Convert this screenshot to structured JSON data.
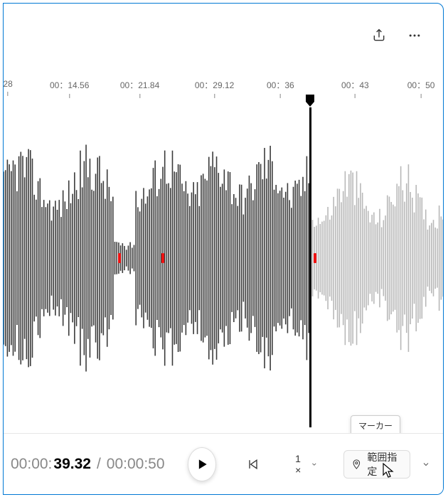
{
  "ruler": {
    "ticks": [
      {
        "label": "28",
        "x_pct": 1
      },
      {
        "label": "00：14.56",
        "x_pct": 15
      },
      {
        "label": "00：21.84",
        "x_pct": 31
      },
      {
        "label": "00：29.12",
        "x_pct": 48
      },
      {
        "label": "00：36",
        "x_pct": 63
      },
      {
        "label": "00：43",
        "x_pct": 80
      },
      {
        "label": "00：50",
        "x_pct": 95
      }
    ]
  },
  "playhead": {
    "x_pct": 69.5
  },
  "markers": [
    {
      "x_pct": 26
    },
    {
      "x_pct": 36
    },
    {
      "x_pct": 70.5
    }
  ],
  "tooltip": {
    "text": "マーカー"
  },
  "time": {
    "current_prefix": "00:00:",
    "current_main": "39.32",
    "separator": "/",
    "total": "00:00:50"
  },
  "speed": {
    "label": "1 ×"
  },
  "range": {
    "label": "範囲指定"
  },
  "icons": {
    "share": "share-icon",
    "more": "more-icon",
    "play": "play-icon",
    "skip_back": "skip-back-icon",
    "chevron_down": "chevron-down-icon",
    "marker_pin": "pin-icon"
  },
  "colors": {
    "accent": "#0078d4",
    "marker": "#e11"
  },
  "chart_data": {
    "type": "waveform",
    "channels": 1,
    "samples_generated": true,
    "played_ratio": 0.695
  }
}
